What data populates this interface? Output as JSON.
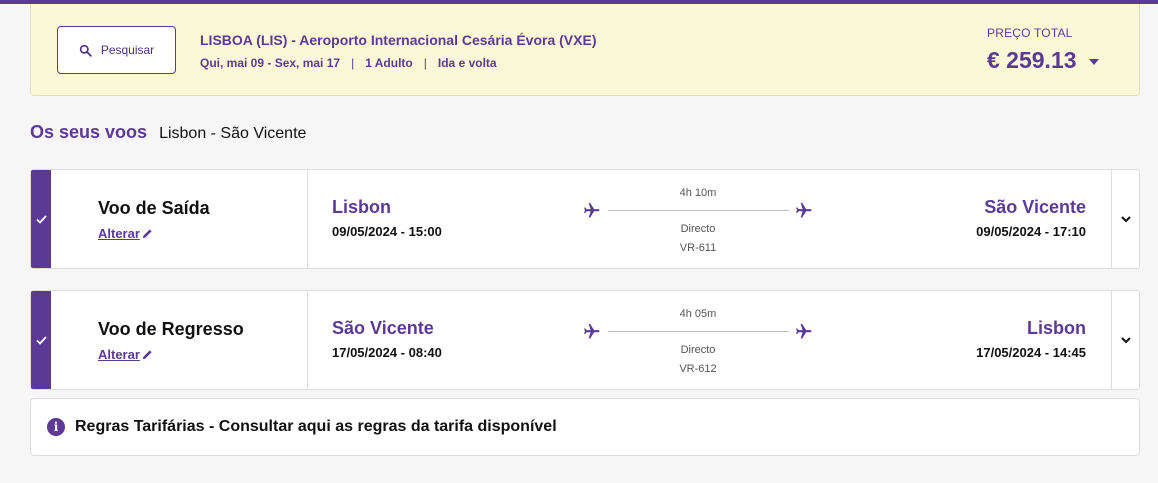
{
  "colors": {
    "brand": "#5b3a97",
    "summary_bg": "#fbf8d8"
  },
  "search": {
    "button_label": "Pesquisar",
    "icon": "search-icon"
  },
  "trip": {
    "route": "LISBOA (LIS) - Aeroporto Internacional Cesária Évora (VXE)",
    "dates": "Qui, mai 09 - Sex, mai 17",
    "passengers": "1 Adulto",
    "trip_type": "Ida e volta",
    "separator": "|"
  },
  "price": {
    "label": "PREÇO TOTAL",
    "value": "€ 259.13"
  },
  "flights_section": {
    "heading": "Os seus voos",
    "route": "Lisbon - São Vicente"
  },
  "flights": [
    {
      "leg_title": "Voo de Saída",
      "change_label": "Alterar",
      "origin_city": "Lisbon",
      "origin_datetime": "09/05/2024 - 15:00",
      "duration": "4h 10m",
      "stops": "Directo",
      "flight_number": "VR-611",
      "dest_city": "São Vicente",
      "dest_datetime": "09/05/2024 - 17:10"
    },
    {
      "leg_title": "Voo de Regresso",
      "change_label": "Alterar",
      "origin_city": "São Vicente",
      "origin_datetime": "17/05/2024 - 08:40",
      "duration": "4h 05m",
      "stops": "Directo",
      "flight_number": "VR-612",
      "dest_city": "Lisbon",
      "dest_datetime": "17/05/2024 - 14:45"
    }
  ],
  "fare_rules": {
    "text": "Regras Tarifárias - Consultar aqui as regras da tarifa disponível",
    "icon": "info-icon"
  }
}
